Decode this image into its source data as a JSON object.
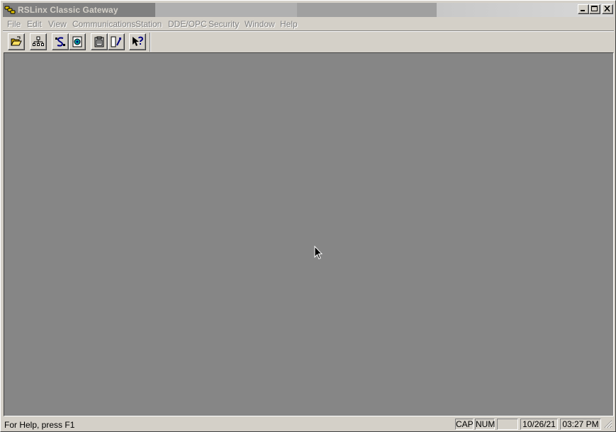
{
  "window": {
    "title": "RSLinx Classic Gateway",
    "app_icon": "rslinx-chain-icon",
    "controls": [
      "minimize-icon",
      "maximize-icon",
      "close-icon"
    ]
  },
  "menu": {
    "items": [
      {
        "label": "File"
      },
      {
        "label": "Edit"
      },
      {
        "label": "View"
      },
      {
        "label": "Communications"
      },
      {
        "label": "Station"
      },
      {
        "label": "DDE/OPC"
      },
      {
        "label": "Security"
      },
      {
        "label": "Window"
      },
      {
        "label": "Help"
      }
    ]
  },
  "toolbar": {
    "buttons": [
      {
        "icon": "open-folder-icon"
      },
      {
        "icon": "rswho-network-icon"
      },
      {
        "icon": "configure-drivers-icon"
      },
      {
        "icon": "driver-diagnostics-icon"
      },
      {
        "icon": "topic-configuration-icon"
      },
      {
        "icon": "opc-test-icon"
      },
      {
        "icon": "context-help-icon"
      }
    ]
  },
  "workspace": {
    "background": "#868686"
  },
  "status": {
    "help_text": "For Help, press F1",
    "cap": "CAP",
    "num": "NUM",
    "scrl": "",
    "date": "10/26/21",
    "time": "03:27 PM"
  },
  "colors": {
    "chrome": "#d4d0c8",
    "menu_disabled": "#808080",
    "title_inactive": "#808080"
  }
}
